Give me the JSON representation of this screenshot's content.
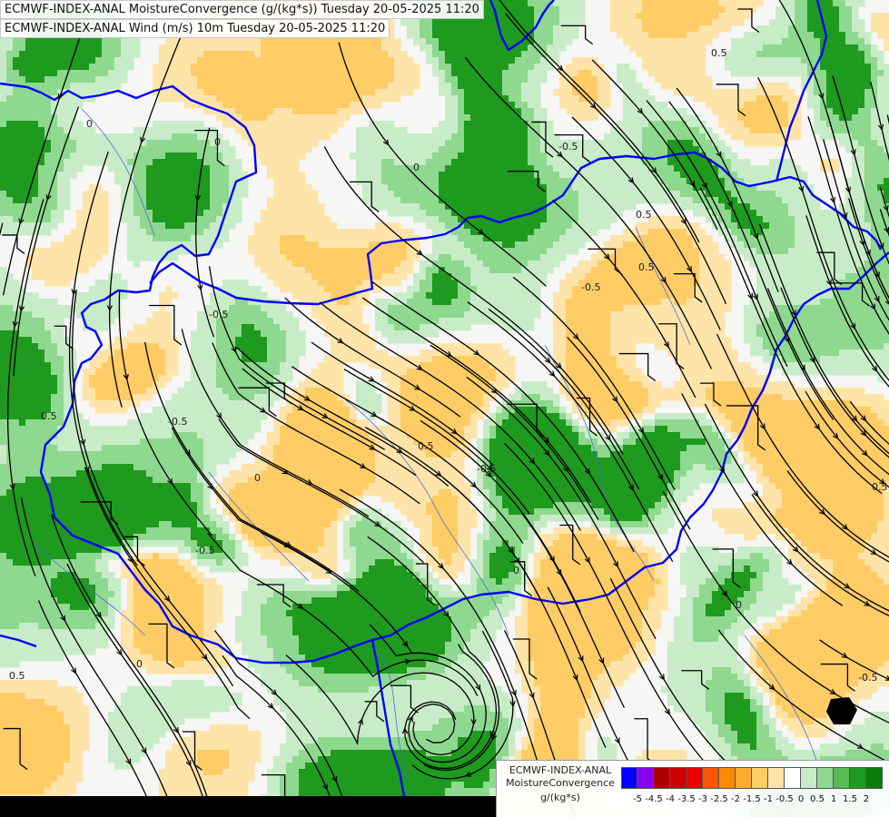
{
  "titles": {
    "line1": "ECMWF-INDEX-ANAL MoistureConvergence (g/(kg*s)) Tuesday 20-05-2025 11:20",
    "line2": "ECMWF-INDEX-ANAL Wind (m/s) 10m Tuesday 20-05-2025 11:20"
  },
  "legend": {
    "line1": "ECMWF-INDEX-ANAL",
    "line2": "MoistureConvergence",
    "line3": "g/(kg*s)",
    "tick_labels": [
      "-5",
      "-4.5",
      "-4",
      "-3.5",
      "-3",
      "-2.5",
      "-2",
      "-1.5",
      "-1",
      "-0.5",
      "0",
      "0.5",
      "1",
      "1.5",
      "2"
    ],
    "colors": [
      "#0000ff",
      "#8800ee",
      "#aa0000",
      "#cc0000",
      "#ee0000",
      "#ff5500",
      "#ff8800",
      "#ffaa33",
      "#ffcc66",
      "#ffe4aa",
      "#ffffff",
      "#c8ecc8",
      "#8fd88f",
      "#55bb55",
      "#1e9a1e",
      "#0a7d0a"
    ]
  },
  "contour_labels": [
    "0",
    "0.5",
    "-0.5",
    "0",
    "0.5",
    "-0.5",
    "0",
    "0.5",
    "-0.5",
    "0",
    "0.5",
    "-0.5",
    "0",
    "0.5",
    "-0.5",
    "0",
    "0.5",
    "-0.5",
    "0",
    "0.5",
    "-0.5"
  ],
  "colors": {
    "border": "#0000ff",
    "streamline": "#000000",
    "river": "#4a6fd0",
    "convergence_strong": "#1e9a1e",
    "convergence_mid": "#8fd88f",
    "convergence_weak": "#c8ecc8",
    "divergence_weak": "#ffe4aa",
    "divergence_mid": "#ffcc66"
  }
}
